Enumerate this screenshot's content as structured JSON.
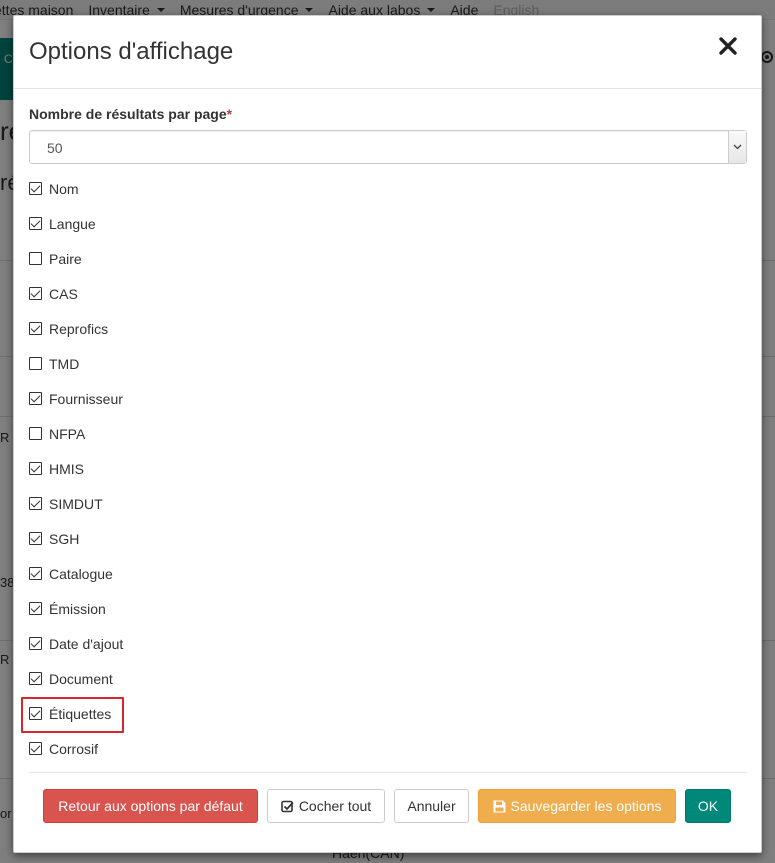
{
  "background": {
    "nav": [
      {
        "label": "ettes maison",
        "caret": false
      },
      {
        "label": "Inventaire",
        "caret": true
      },
      {
        "label": "Mesures d'urgence",
        "caret": true
      },
      {
        "label": "Aide aux labos",
        "caret": true
      },
      {
        "label": "Aide",
        "caret": false
      },
      {
        "label": "English",
        "caret": false,
        "muted": true
      }
    ],
    "green_button_fragment": "C",
    "heading_fragment": "re",
    "heading2_fragment": "ré",
    "row_fragments": [
      "R",
      "38",
      "R",
      "or"
    ],
    "bottom_text": "Haen(CAN)"
  },
  "modal": {
    "title": "Options d'affichage",
    "close_icon": "close-icon",
    "results_label": "Nombre de résultats par page",
    "required_mark": "*",
    "results_value": "50",
    "columns": [
      {
        "label": "Nom",
        "checked": true
      },
      {
        "label": "Langue",
        "checked": true
      },
      {
        "label": "Paire",
        "checked": false
      },
      {
        "label": "CAS",
        "checked": true
      },
      {
        "label": "Reprofics",
        "checked": true
      },
      {
        "label": "TMD",
        "checked": false
      },
      {
        "label": "Fournisseur",
        "checked": true
      },
      {
        "label": "NFPA",
        "checked": false
      },
      {
        "label": "HMIS",
        "checked": true
      },
      {
        "label": "SIMDUT",
        "checked": true
      },
      {
        "label": "SGH",
        "checked": true
      },
      {
        "label": "Catalogue",
        "checked": true
      },
      {
        "label": "Émission",
        "checked": true
      },
      {
        "label": "Date d'ajout",
        "checked": true
      },
      {
        "label": "Document",
        "checked": true
      },
      {
        "label": "Étiquettes",
        "checked": true,
        "highlighted": true
      },
      {
        "label": "Corrosif",
        "checked": true
      }
    ],
    "footer": {
      "reset_label": "Retour aux options par défaut",
      "check_all_label": "Cocher tout",
      "cancel_label": "Annuler",
      "save_label": "Sauvegarder les options",
      "ok_label": "OK"
    }
  },
  "colors": {
    "danger": "#d9534f",
    "warning": "#f0ad4e",
    "success": "#00897b",
    "highlight": "#d9262d"
  }
}
